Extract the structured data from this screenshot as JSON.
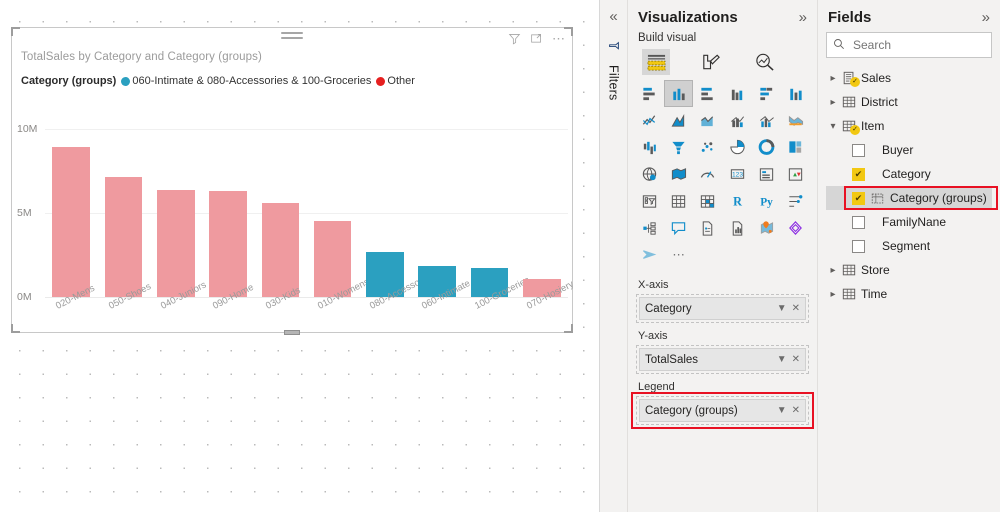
{
  "visual": {
    "title": "TotalSales by Category and Category (groups)",
    "header_icons": [
      "filter-icon",
      "focus-mode-icon",
      "more-options-icon"
    ],
    "legend": {
      "title": "Category (groups)",
      "items": [
        {
          "label": "060-Intimate & 080-Accessories & 100-Groceries",
          "color": "#2ba0c0"
        },
        {
          "label": "Other",
          "color": "#e62020"
        }
      ]
    }
  },
  "chart_data": {
    "type": "bar",
    "title": "TotalSales by Category and Category (groups)",
    "xlabel": "Category",
    "ylabel": "TotalSales",
    "ylim": [
      0,
      10000000
    ],
    "yticks": [
      "0M",
      "5M",
      "10M"
    ],
    "grid": true,
    "legend_position": "top",
    "categories": [
      "020-Mens",
      "050-Shoes",
      "040-Juniors",
      "090-Home",
      "030-Kids",
      "010-Womens",
      "080-Accessories",
      "060-Intimate",
      "100-Groceries",
      "070-Hosiery"
    ],
    "values": [
      8900000,
      7150000,
      6350000,
      6300000,
      5600000,
      4550000,
      2700000,
      1850000,
      1700000,
      1100000
    ],
    "colors": [
      "#ef9a9f",
      "#ef9a9f",
      "#ef9a9f",
      "#ef9a9f",
      "#ef9a9f",
      "#ef9a9f",
      "#2ba0c0",
      "#2ba0c0",
      "#2ba0c0",
      "#ef9a9f"
    ],
    "series": [
      {
        "name": "060-Intimate & 080-Accessories & 100-Groceries",
        "color": "#2ba0c0"
      },
      {
        "name": "Other",
        "color": "#ef9a9f"
      }
    ]
  },
  "filters_rail": {
    "collapse_label": "«",
    "label": "Filters",
    "icon": "filter-arrow-icon"
  },
  "visualizations": {
    "title": "Visualizations",
    "expand_label": "»",
    "build_visual_label": "Build visual",
    "top_icons": [
      "build-visual-icon",
      "format-visual-icon",
      "analytics-icon"
    ],
    "gallery": [
      "stacked-bar-chart",
      "stacked-column-chart",
      "clustered-bar-chart",
      "clustered-column-chart",
      "100-percent-stacked-bar-chart",
      "100-percent-stacked-column-chart",
      "line-chart",
      "area-chart",
      "stacked-area-chart",
      "line-and-stacked-column-chart",
      "line-and-clustered-column-chart",
      "ribbon-chart",
      "waterfall-chart",
      "funnel-chart",
      "scatter-chart",
      "pie-chart",
      "donut-chart",
      "treemap",
      "map",
      "filled-map",
      "gauge",
      "card",
      "multi-row-card",
      "kpi",
      "slicer",
      "table",
      "matrix",
      "r-script-visual",
      "python-visual",
      "key-influencers",
      "decomposition-tree",
      "q-and-a",
      "narrative",
      "paginated-report",
      "azure-map",
      "power-apps",
      "power-automate",
      "more-options"
    ],
    "selected_gallery_index": 1,
    "wells": [
      {
        "label": "X-axis",
        "value": "Category",
        "highlight": false
      },
      {
        "label": "Y-axis",
        "value": "TotalSales",
        "highlight": false
      },
      {
        "label": "Legend",
        "value": "Category (groups)",
        "highlight": true
      }
    ]
  },
  "fields": {
    "title": "Fields",
    "expand_label": "»",
    "search": {
      "placeholder": "Search",
      "value": ""
    },
    "tree": [
      {
        "name": "Sales",
        "expanded": false,
        "icon": "measure-table-icon",
        "checked_badge": true,
        "children": []
      },
      {
        "name": "District",
        "expanded": false,
        "icon": "table-icon",
        "checked_badge": false,
        "children": []
      },
      {
        "name": "Item",
        "expanded": true,
        "icon": "table-icon",
        "checked_badge": true,
        "children": [
          {
            "name": "Buyer",
            "checked": false,
            "group": false,
            "highlight": false
          },
          {
            "name": "Category",
            "checked": true,
            "group": false,
            "highlight": false
          },
          {
            "name": "Category (groups)",
            "checked": true,
            "group": true,
            "highlight": true
          },
          {
            "name": "FamilyNane",
            "checked": false,
            "group": false,
            "highlight": false
          },
          {
            "name": "Segment",
            "checked": false,
            "group": false,
            "highlight": false
          }
        ]
      },
      {
        "name": "Store",
        "expanded": false,
        "icon": "table-icon",
        "checked_badge": false,
        "children": []
      },
      {
        "name": "Time",
        "expanded": false,
        "icon": "table-icon",
        "checked_badge": false,
        "children": []
      }
    ]
  }
}
